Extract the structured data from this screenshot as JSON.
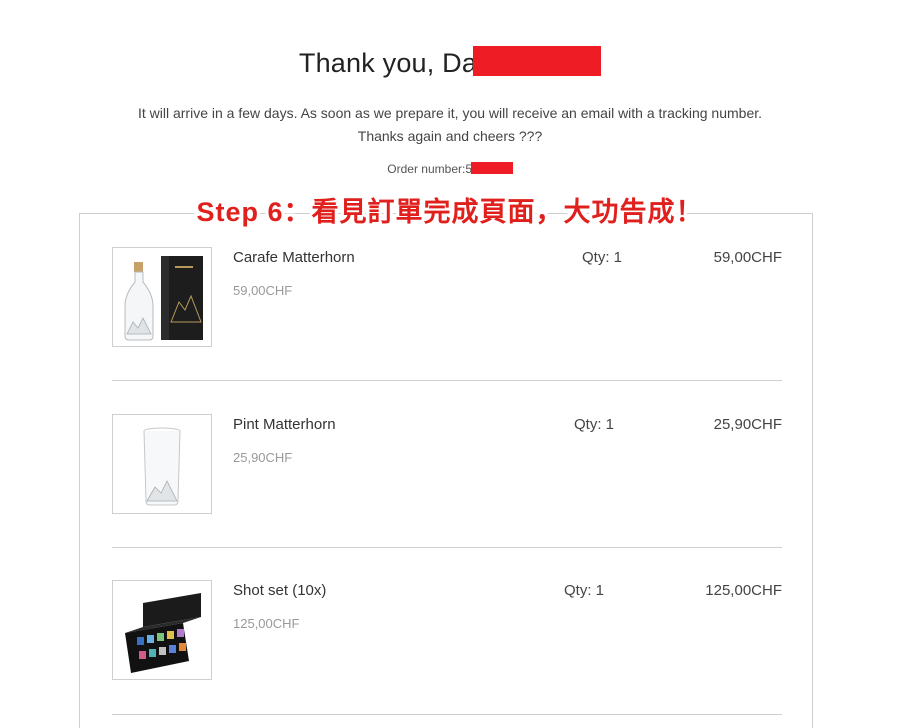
{
  "header": {
    "title_prefix": "Thank you, Da",
    "message_line1": "It will arrive in a few days. As soon as we prepare it, you will receive an email with a tracking number.",
    "message_line2": "Thanks again and cheers ???",
    "order_number_label": "Order number:59",
    "redaction_color": "#ee1c25"
  },
  "overlay": {
    "caption": "Step 6：看見訂單完成頁面，大功告成！",
    "color": "#e0201d"
  },
  "items": [
    {
      "name": "Carafe Matterhorn",
      "unit_price": "59,00CHF",
      "qty": "Qty: 1",
      "total": "59,00CHF",
      "image_icon": "carafe-product-image"
    },
    {
      "name": "Pint Matterhorn",
      "unit_price": "25,90CHF",
      "qty": "Qty: 1",
      "total": "25,90CHF",
      "image_icon": "pint-glass-product-image"
    },
    {
      "name": "Shot set (10x)",
      "unit_price": "125,00CHF",
      "qty": "Qty: 1",
      "total": "125,00CHF",
      "image_icon": "shot-set-product-image"
    }
  ]
}
